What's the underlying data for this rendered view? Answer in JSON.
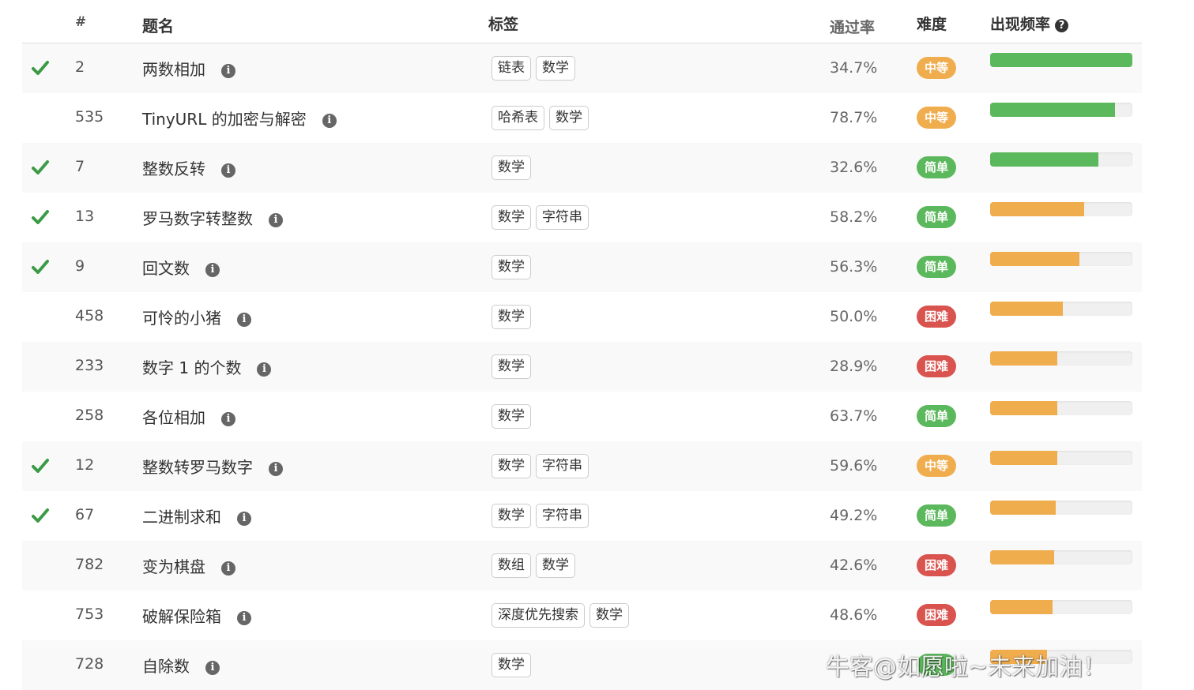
{
  "header": {
    "num": "#",
    "title": "题名",
    "tags": "标签",
    "rate": "通过率",
    "difficulty": "难度",
    "frequency": "出现频率",
    "help_icon": "question-circle-icon"
  },
  "colors": {
    "check": "#3a9a45",
    "easy": "#5cb85c",
    "medium": "#f0ad4e",
    "hard": "#d9534f",
    "bar_high": "#5cb85c",
    "bar_mid": "#f0ad4e"
  },
  "rows": [
    {
      "solved": true,
      "id": "2",
      "title": "两数相加",
      "tags": [
        "链表",
        "数学"
      ],
      "rate": "34.7%",
      "difficulty": "中等",
      "level": "medium",
      "frequency": 1.0,
      "bar": "high"
    },
    {
      "solved": false,
      "id": "535",
      "title": "TinyURL 的加密与解密",
      "tags": [
        "哈希表",
        "数学"
      ],
      "rate": "78.7%",
      "difficulty": "中等",
      "level": "medium",
      "frequency": 0.88,
      "bar": "high"
    },
    {
      "solved": true,
      "id": "7",
      "title": "整数反转",
      "tags": [
        "数学"
      ],
      "rate": "32.6%",
      "difficulty": "简单",
      "level": "easy",
      "frequency": 0.76,
      "bar": "high"
    },
    {
      "solved": true,
      "id": "13",
      "title": "罗马数字转整数",
      "tags": [
        "数学",
        "字符串"
      ],
      "rate": "58.2%",
      "difficulty": "简单",
      "level": "easy",
      "frequency": 0.66,
      "bar": "mid"
    },
    {
      "solved": true,
      "id": "9",
      "title": "回文数",
      "tags": [
        "数学"
      ],
      "rate": "56.3%",
      "difficulty": "简单",
      "level": "easy",
      "frequency": 0.63,
      "bar": "mid"
    },
    {
      "solved": false,
      "id": "458",
      "title": "可怜的小猪",
      "tags": [
        "数学"
      ],
      "rate": "50.0%",
      "difficulty": "困难",
      "level": "hard",
      "frequency": 0.51,
      "bar": "mid"
    },
    {
      "solved": false,
      "id": "233",
      "title": "数字 1 的个数",
      "tags": [
        "数学"
      ],
      "rate": "28.9%",
      "difficulty": "困难",
      "level": "hard",
      "frequency": 0.47,
      "bar": "mid"
    },
    {
      "solved": false,
      "id": "258",
      "title": "各位相加",
      "tags": [
        "数学"
      ],
      "rate": "63.7%",
      "difficulty": "简单",
      "level": "easy",
      "frequency": 0.47,
      "bar": "mid"
    },
    {
      "solved": true,
      "id": "12",
      "title": "整数转罗马数字",
      "tags": [
        "数学",
        "字符串"
      ],
      "rate": "59.6%",
      "difficulty": "中等",
      "level": "medium",
      "frequency": 0.47,
      "bar": "mid"
    },
    {
      "solved": true,
      "id": "67",
      "title": "二进制求和",
      "tags": [
        "数学",
        "字符串"
      ],
      "rate": "49.2%",
      "difficulty": "简单",
      "level": "easy",
      "frequency": 0.46,
      "bar": "mid"
    },
    {
      "solved": false,
      "id": "782",
      "title": "变为棋盘",
      "tags": [
        "数组",
        "数学"
      ],
      "rate": "42.6%",
      "difficulty": "困难",
      "level": "hard",
      "frequency": 0.45,
      "bar": "mid"
    },
    {
      "solved": false,
      "id": "753",
      "title": "破解保险箱",
      "tags": [
        "深度优先搜索",
        "数学"
      ],
      "rate": "48.6%",
      "difficulty": "困难",
      "level": "hard",
      "frequency": 0.44,
      "bar": "mid"
    },
    {
      "solved": false,
      "id": "728",
      "title": "自除数",
      "tags": [
        "数学"
      ],
      "rate": "",
      "difficulty": "",
      "level": "easy",
      "frequency": 0.4,
      "bar": "mid"
    }
  ],
  "watermark": "牛客@如愿啦~未来加油！"
}
